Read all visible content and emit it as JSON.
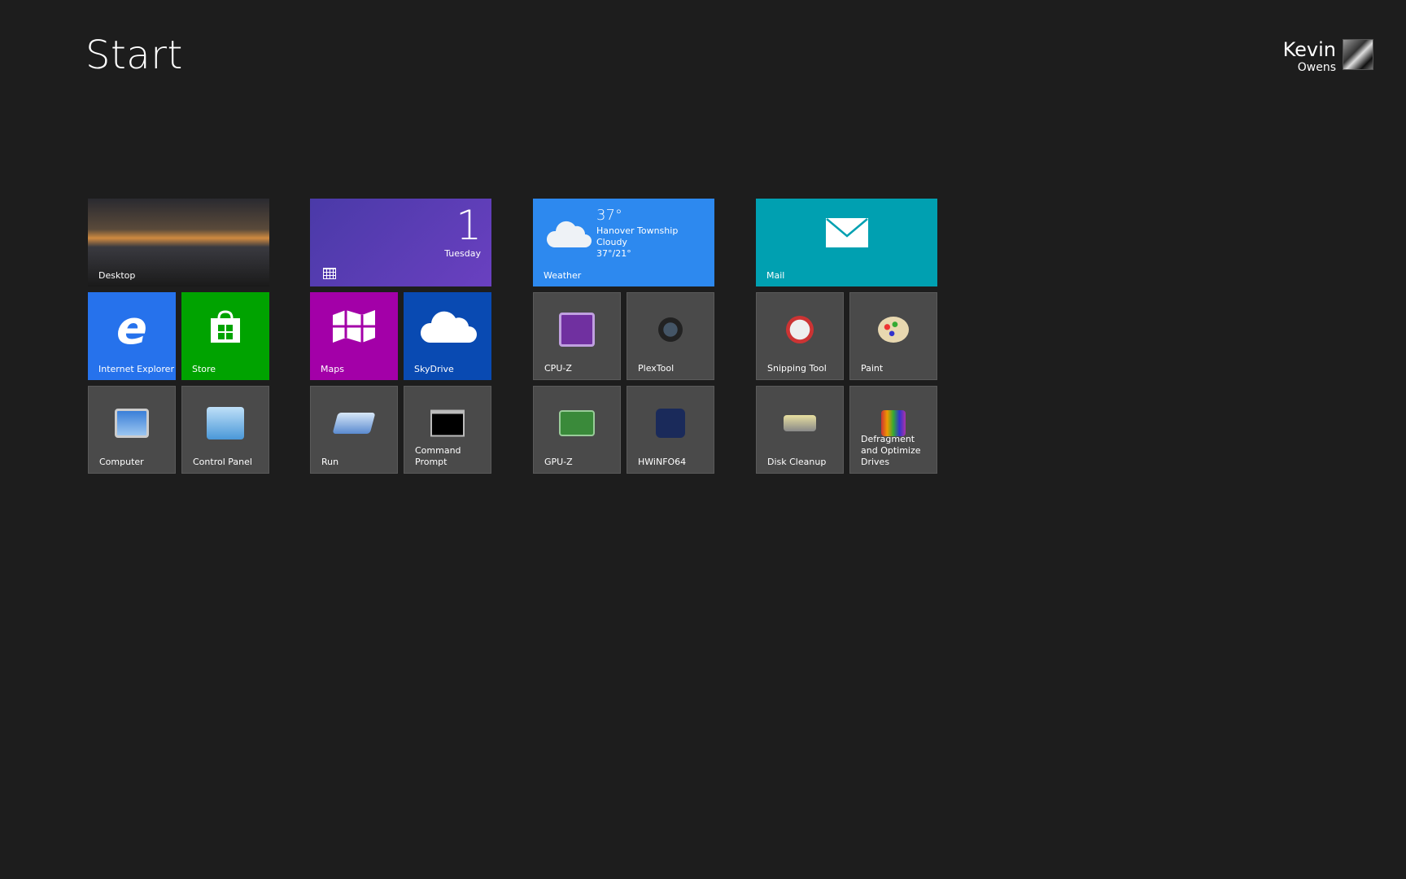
{
  "header": {
    "title": "Start",
    "user_first": "Kevin",
    "user_last": "Owens"
  },
  "tiles": {
    "desktop": "Desktop",
    "calendar": {
      "day": "1",
      "weekday": "Tuesday"
    },
    "weather": {
      "label": "Weather",
      "temp": "37°",
      "location": "Hanover Township",
      "condition": "Cloudy",
      "range": "37°/21°"
    },
    "mail": "Mail",
    "ie": "Internet Explorer",
    "store": "Store",
    "maps": "Maps",
    "skydrive": "SkyDrive",
    "cpuz": "CPU-Z",
    "plextool": "PlexTool",
    "snipping": "Snipping Tool",
    "paint": "Paint",
    "computer": "Computer",
    "control_panel": "Control Panel",
    "run": "Run",
    "cmd": "Command Prompt",
    "gpuz": "GPU-Z",
    "hwinfo": "HWiNFO64",
    "disk_cleanup": "Disk Cleanup",
    "defrag": "Defragment and Optimize Drives"
  },
  "colors": {
    "background": "#1d1d1d",
    "ie": "#2672ec",
    "store": "#00a300",
    "maps": "#a300a8",
    "skydrive": "#094ab2",
    "calendar": "#5a3bb0",
    "weather": "#2d89ef",
    "mail": "#00a0b1"
  }
}
